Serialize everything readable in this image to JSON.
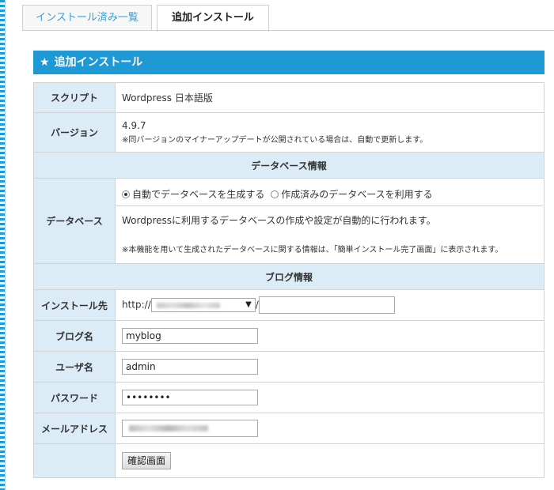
{
  "tabs": {
    "installed_label": "インストール済み一覧",
    "add_label": "追加インストール"
  },
  "header": {
    "title": "追加インストール",
    "icon": "star-icon"
  },
  "rows": {
    "script_label": "スクリプト",
    "script_value": "Wordpress 日本語版",
    "version_label": "バージョン",
    "version_value": "4.9.7",
    "version_note": "※同バージョンのマイナーアップデートが公開されている場合は、自動で更新します。",
    "db_section": "データベース情報",
    "db_label": "データベース",
    "db_option_auto": "自動でデータベースを生成する",
    "db_option_existing": "作成済みのデータベースを利用する",
    "db_desc": "Wordpressに利用するデータベースの作成や設定が自動的に行われます。",
    "db_note": "※本機能を用いて生成されたデータベースに関する情報は、「簡単インストール完了画面」に表示されます。",
    "blog_section": "ブログ情報",
    "install_label": "インストール先",
    "install_prefix": "http://",
    "install_slash": "/",
    "install_path_value": "",
    "blogname_label": "ブログ名",
    "blogname_value": "myblog",
    "user_label": "ユーザ名",
    "user_value": "admin",
    "password_label": "パスワード",
    "password_value": "••••••••",
    "email_label": "メールアドレス",
    "confirm_button": "確認画面"
  },
  "colors": {
    "accent": "#1f98d6",
    "label_bg": "#dcecf7",
    "tab_link": "#3a9fd0"
  }
}
